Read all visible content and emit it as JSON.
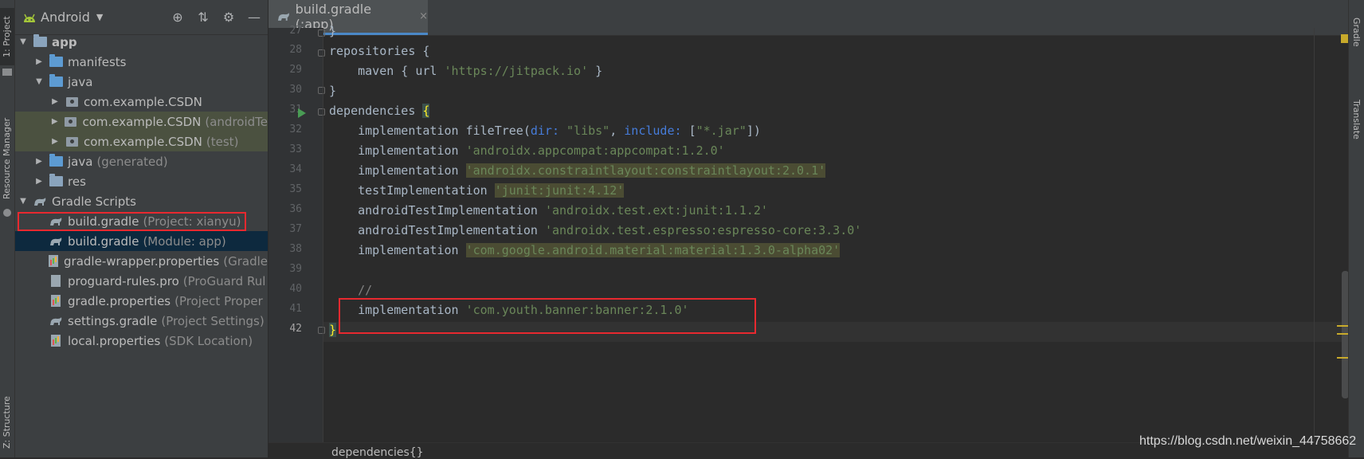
{
  "left_strip": {
    "tab_project": "1: Project",
    "tab_resource_manager": "Resource Manager",
    "tab_structure": "Z: Structure"
  },
  "right_strip": {
    "tab_gradle": "Gradle",
    "tab_translate": "Translate"
  },
  "project_panel": {
    "view_name": "Android",
    "tree": [
      {
        "label": "app",
        "suffix": "",
        "icon": "module-folder-icon"
      },
      {
        "label": "manifests",
        "suffix": "",
        "icon": "folder-icon"
      },
      {
        "label": "java",
        "suffix": "",
        "icon": "folder-icon"
      },
      {
        "label": "com.example.CSDN",
        "suffix": "",
        "icon": "package-icon"
      },
      {
        "label": "com.example.CSDN",
        "suffix": "(androidTe",
        "icon": "package-icon"
      },
      {
        "label": "com.example.CSDN",
        "suffix": "(test)",
        "icon": "package-icon"
      },
      {
        "label": "java",
        "suffix": "(generated)",
        "icon": "generated-folder-icon"
      },
      {
        "label": "res",
        "suffix": "",
        "icon": "res-folder-icon"
      },
      {
        "label": "Gradle Scripts",
        "suffix": "",
        "icon": "gradle-icon"
      },
      {
        "label": "build.gradle",
        "suffix": "(Project: xianyu)",
        "icon": "gradle-icon"
      },
      {
        "label": "build.gradle",
        "suffix": "(Module: app)",
        "icon": "gradle-icon"
      },
      {
        "label": "gradle-wrapper.properties",
        "suffix": "(Gradle",
        "icon": "properties-icon"
      },
      {
        "label": "proguard-rules.pro",
        "suffix": "(ProGuard Rul",
        "icon": "text-file-icon"
      },
      {
        "label": "gradle.properties",
        "suffix": "(Project Proper",
        "icon": "properties-icon"
      },
      {
        "label": "settings.gradle",
        "suffix": "(Project Settings)",
        "icon": "gradle-icon"
      },
      {
        "label": "local.properties",
        "suffix": "(SDK Location)",
        "icon": "properties-icon"
      }
    ]
  },
  "editor": {
    "tab_label": "build.gradle (:app)",
    "tab_close": "×",
    "line_numbers": [
      "27",
      "28",
      "29",
      "30",
      "31",
      "32",
      "33",
      "34",
      "35",
      "36",
      "37",
      "38",
      "39",
      "40",
      "41",
      "42"
    ],
    "lines": {
      "l27": "}",
      "l28": "repositories {",
      "l29_a": "    maven { url ",
      "l29_b": "'https://jitpack.io'",
      "l29_c": " }",
      "l30": "}",
      "l31_a": "dependencies ",
      "l31_b": "{",
      "l32_a": "    implementation fileTree(",
      "l32_b": "dir: ",
      "l32_c": "\"libs\"",
      "l32_d": ", ",
      "l32_e": "include: ",
      "l32_f": "[",
      "l32_g": "\"*.jar\"",
      "l32_h": "])",
      "l33_a": "    implementation ",
      "l33_b": "'androidx.appcompat:appcompat:1.2.0'",
      "l34_a": "    implementation ",
      "l34_b": "'androidx.constraintlayout:constraintlayout:2.0.1'",
      "l35_a": "    testImplementation ",
      "l35_b": "'junit:junit:4.12'",
      "l36_a": "    androidTestImplementation ",
      "l36_b": "'androidx.test.ext:junit:1.1.2'",
      "l37_a": "    androidTestImplementation ",
      "l37_b": "'androidx.test.espresso:espresso-core:3.3.0'",
      "l38_a": "    implementation ",
      "l38_b": "'com.google.android.material:material:1.3.0-alpha02'",
      "l39": "",
      "l40": "    //",
      "l41_a": "    implementation ",
      "l41_b": "'com.youth.banner:banner:2.1.0'",
      "l42": "}"
    },
    "breadcrumb": "dependencies{}"
  },
  "watermark": "https://blog.csdn.net/weixin_44758662",
  "colors": {
    "highlight_box": "#e8292f",
    "string": "#6a8759",
    "selection": "#0d293e"
  }
}
